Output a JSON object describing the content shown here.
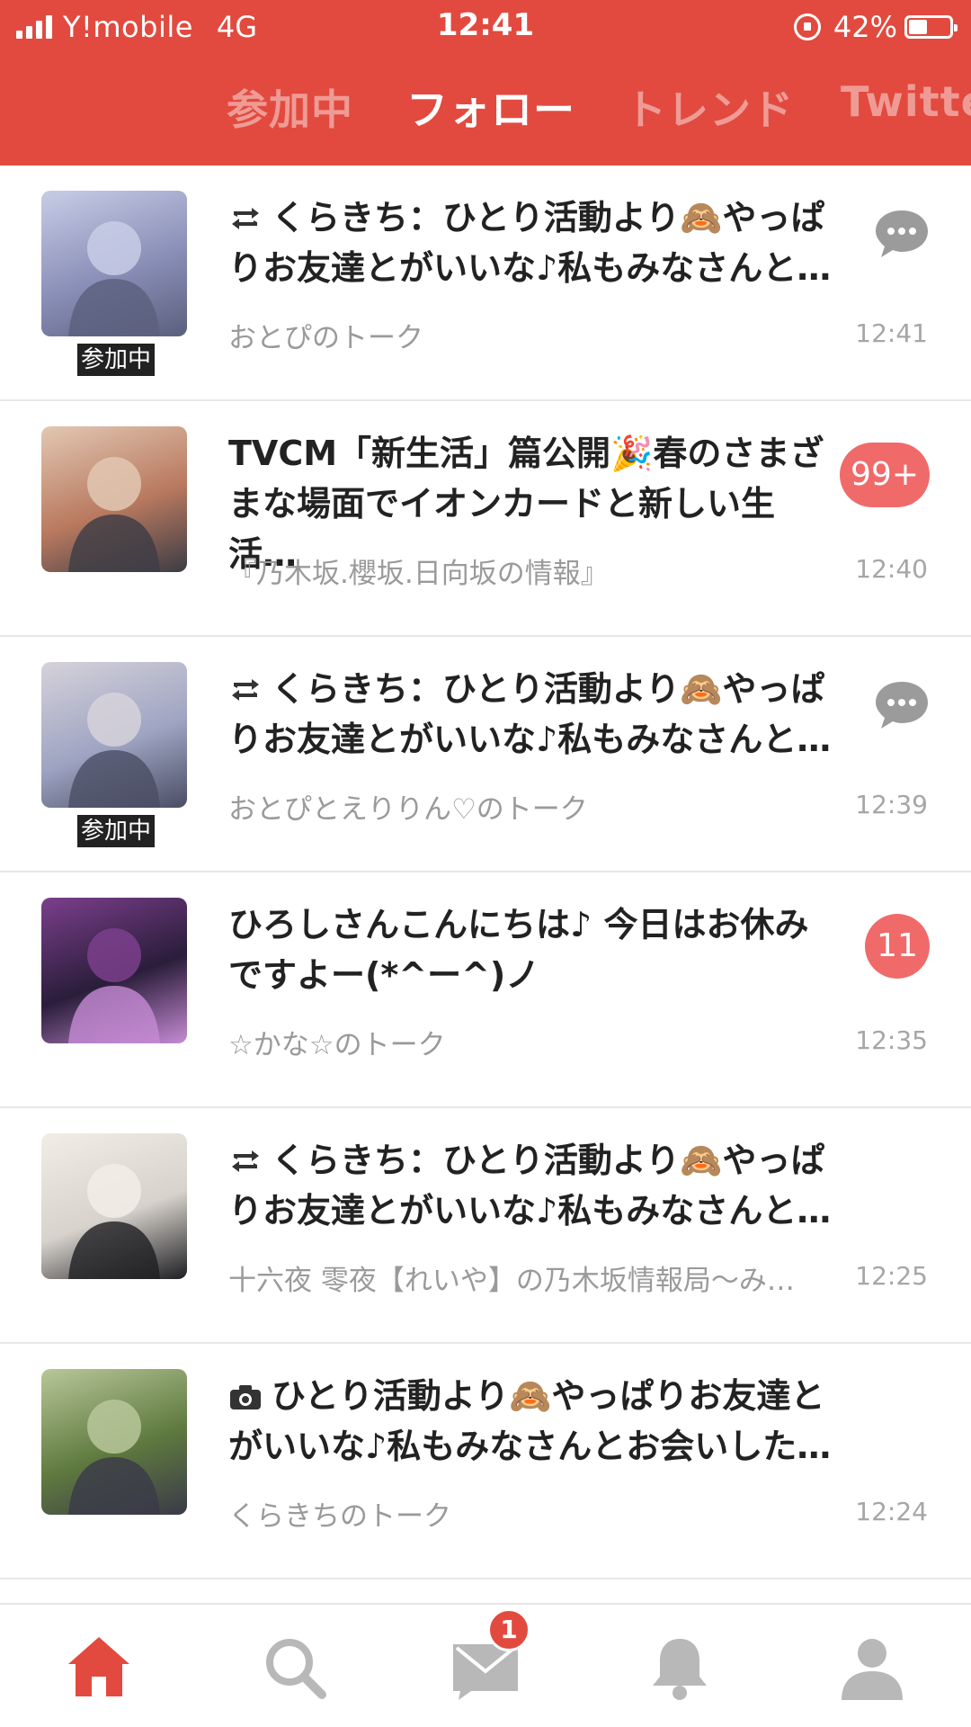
{
  "status_bar": {
    "carrier": "Y!mobile",
    "network": "4G",
    "time": "12:41",
    "battery_percent": "42%",
    "battery_level": 0.42
  },
  "tabs": [
    {
      "label": "参加中",
      "active": false
    },
    {
      "label": "フォロー",
      "active": true
    },
    {
      "label": "トレンド",
      "active": false
    },
    {
      "label": "Twitte",
      "active": false
    }
  ],
  "feed": [
    {
      "lead_icon": "retweet-icon",
      "text": "くらきち：ひとり活動より🙈やっぱりお友達とがいいな♪私もみなさんと…",
      "source": "おとぴのトーク",
      "time": "12:41",
      "thumb_label": "参加中",
      "indicator": "chat-bubble-icon",
      "thumb_colors": [
        "#8a8fb8",
        "#c8cde6",
        "#5b5f7d"
      ]
    },
    {
      "lead_icon": "",
      "text": "TVCM「新生活」篇公開🎉春のさまざまな場面でイオンカードと新しい生活…",
      "source": "『乃木坂.櫻坂.日向坂の情報』",
      "time": "12:40",
      "thumb_label": "",
      "indicator": "badge",
      "badge": "99+",
      "thumb_colors": [
        "#b9795f",
        "#e2c8b3",
        "#3c3c45"
      ]
    },
    {
      "lead_icon": "retweet-icon",
      "text": "くらきち：ひとり活動より🙈やっぱりお友達とがいいな♪私もみなさんと…",
      "source": "おとぴとえりりん♡のトーク",
      "time": "12:39",
      "thumb_label": "参加中",
      "indicator": "chat-bubble-icon",
      "thumb_colors": [
        "#9ea4c2",
        "#d6d2da",
        "#4a4d64"
      ]
    },
    {
      "lead_icon": "",
      "text": "ひろしさんこんにちは♪ 今日はお休みですよー(*^ー^)ノ",
      "source": "☆かな☆のトーク",
      "time": "12:35",
      "thumb_label": "",
      "indicator": "badge",
      "badge": "11",
      "thumb_colors": [
        "#2a1d3a",
        "#7b3f8c",
        "#c68bd4"
      ]
    },
    {
      "lead_icon": "retweet-icon",
      "text": "くらきち：ひとり活動より🙈やっぱりお友達とがいいな♪私もみなさんと…",
      "source": "十六夜 零夜【れいや】の乃木坂情報局〜み…",
      "time": "12:25",
      "thumb_label": "",
      "indicator": "none",
      "thumb_colors": [
        "#d7d2cc",
        "#f2ede6",
        "#1e1e22"
      ]
    },
    {
      "lead_icon": "camera-icon",
      "text": "ひとり活動より🙈やっぱりお友達とがいいな♪私もみなさんとお会いした…",
      "source": "くらきちのトーク",
      "time": "12:24",
      "thumb_label": "",
      "indicator": "none",
      "thumb_colors": [
        "#5f7a3f",
        "#b8c79a",
        "#3a3a48"
      ]
    }
  ],
  "bottom_nav": [
    {
      "icon": "home-icon",
      "active": true
    },
    {
      "icon": "search-icon",
      "active": false
    },
    {
      "icon": "mail-icon",
      "active": false,
      "badge": "1"
    },
    {
      "icon": "bell-icon",
      "active": false
    },
    {
      "icon": "profile-icon",
      "active": false
    }
  ],
  "colors": {
    "brand": "#E24A3F",
    "badge": "#F06A6A",
    "muted": "#9a9a9a",
    "nav_inactive": "#b8b8b8"
  }
}
